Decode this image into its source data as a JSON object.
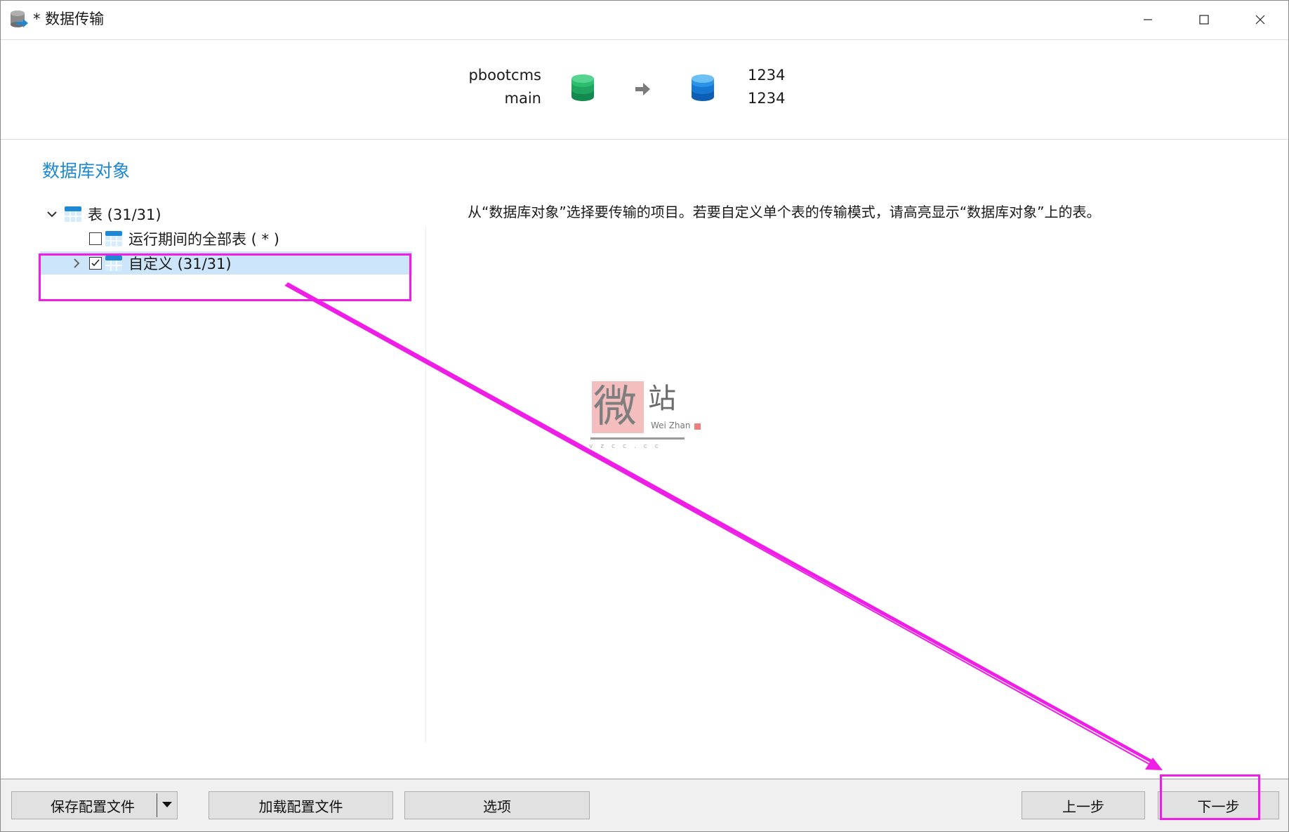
{
  "window": {
    "title": "* 数据传输",
    "controls": [
      "minimize",
      "maximize",
      "close"
    ]
  },
  "connection": {
    "source": {
      "connection": "pbootcms",
      "database": "main",
      "icon": "green-database-icon"
    },
    "target": {
      "connection": "1234",
      "database": "1234",
      "icon": "blue-database-icon"
    }
  },
  "section": {
    "title": "数据库对象"
  },
  "tree": {
    "root": {
      "label": "表 (31/31)",
      "expanded": true
    },
    "runtime_all": {
      "label": "运行期间的全部表 ( * )",
      "checked": false
    },
    "custom": {
      "label": "自定义 (31/31)",
      "checked": true,
      "selected": true
    }
  },
  "instruction": "从“数据库对象”选择要传输的项目。若要自定义单个表的传输模式，请高亮显示“数据库对象”上的表。",
  "watermark": {
    "char1": "微",
    "char2": "站",
    "sub": "Wei Zhan",
    "url": "vzcc.cc"
  },
  "footer": {
    "save_profile": "保存配置文件",
    "load_profile": "加载配置文件",
    "options": "选项",
    "prev": "上一步",
    "next": "下一步"
  },
  "colors": {
    "accent": "#1e88d2",
    "selection": "#cce5fb",
    "annotation": "#ee1ee6"
  }
}
